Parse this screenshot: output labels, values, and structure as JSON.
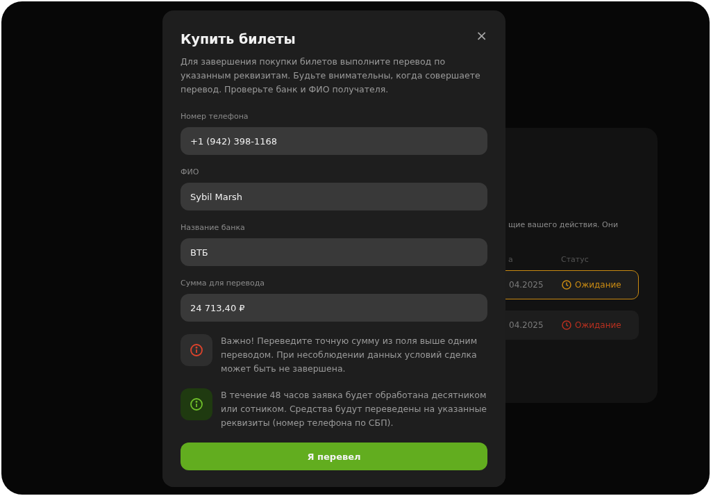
{
  "background_card": {
    "text": "щие вашего действия. Они",
    "columns": [
      "а",
      "Статус"
    ],
    "rows": [
      {
        "date": "04.2025",
        "status": "Ожидание",
        "color": "#c98a12",
        "selected": true
      },
      {
        "date": "04.2025",
        "status": "Ожидание",
        "color": "#b8301f",
        "selected": false
      }
    ]
  },
  "modal": {
    "title": "Купить билеты",
    "close": "×",
    "description": "Для завершения покупки билетов выполните перевод по указанным реквизитам. Будьте внимательны, когда совершаете перевод. Проверьте банк и ФИО получателя.",
    "fields": [
      {
        "label": "Номер телефона",
        "value": "+1 (942) 398-1168"
      },
      {
        "label": "ФИО",
        "value": "Sybil Marsh"
      },
      {
        "label": "Название банка",
        "value": "ВТБ"
      },
      {
        "label": "Сумма для перевода",
        "value": "24 713,40 ₽"
      }
    ],
    "notes": [
      {
        "kind": "warning",
        "text": "Важно! Переведите точную сумму из поля выше одним переводом. При несоблюдении данных условий сделка может быть не завершена."
      },
      {
        "kind": "info",
        "text": "В течение 48 часов заявка будет обработана десятником или сотником. Средства будут переведены на указанные реквизиты (номер телефона по СБП)."
      }
    ],
    "button": "Я перевел"
  }
}
